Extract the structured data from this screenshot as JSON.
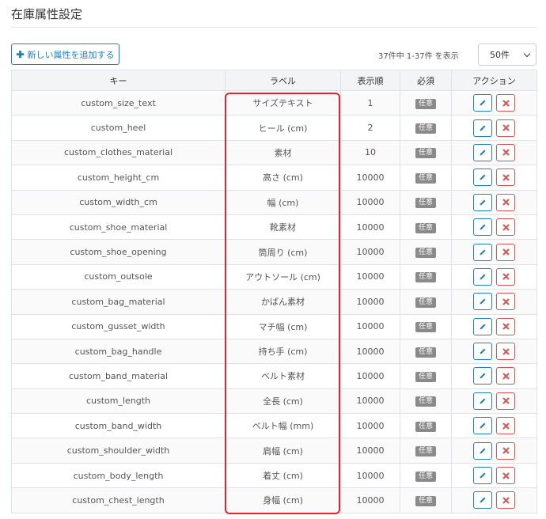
{
  "page": {
    "title": "在庫属性設定"
  },
  "toolbar": {
    "add_label": "新しい属性を追加する",
    "count_text": "37件中 1-37件 を表示",
    "page_size": "50件"
  },
  "table": {
    "headers": {
      "key": "キー",
      "label": "ラベル",
      "order": "表示順",
      "required": "必須",
      "action": "アクション"
    },
    "rows": [
      {
        "key": "custom_size_text",
        "label": "サイズテキスト",
        "order": "1",
        "required": "任意"
      },
      {
        "key": "custom_heel",
        "label": "ヒール (cm)",
        "order": "2",
        "required": "任意"
      },
      {
        "key": "custom_clothes_material",
        "label": "素材",
        "order": "10",
        "required": "任意"
      },
      {
        "key": "custom_height_cm",
        "label": "高さ (cm)",
        "order": "10000",
        "required": "任意"
      },
      {
        "key": "custom_width_cm",
        "label": "幅 (cm)",
        "order": "10000",
        "required": "任意"
      },
      {
        "key": "custom_shoe_material",
        "label": "靴素材",
        "order": "10000",
        "required": "任意"
      },
      {
        "key": "custom_shoe_opening",
        "label": "筒周り (cm)",
        "order": "10000",
        "required": "任意"
      },
      {
        "key": "custom_outsole",
        "label": "アウトソール (cm)",
        "order": "10000",
        "required": "任意"
      },
      {
        "key": "custom_bag_material",
        "label": "かばん素材",
        "order": "10000",
        "required": "任意"
      },
      {
        "key": "custom_gusset_width",
        "label": "マチ幅 (cm)",
        "order": "10000",
        "required": "任意"
      },
      {
        "key": "custom_bag_handle",
        "label": "持ち手 (cm)",
        "order": "10000",
        "required": "任意"
      },
      {
        "key": "custom_band_material",
        "label": "ベルト素材",
        "order": "10000",
        "required": "任意"
      },
      {
        "key": "custom_length",
        "label": "全長 (cm)",
        "order": "10000",
        "required": "任意"
      },
      {
        "key": "custom_band_width",
        "label": "ベルト幅 (mm)",
        "order": "10000",
        "required": "任意"
      },
      {
        "key": "custom_shoulder_width",
        "label": "肩幅 (cm)",
        "order": "10000",
        "required": "任意"
      },
      {
        "key": "custom_body_length",
        "label": "着丈 (cm)",
        "order": "10000",
        "required": "任意"
      },
      {
        "key": "custom_chest_length",
        "label": "身幅 (cm)",
        "order": "10000",
        "required": "任意"
      }
    ]
  },
  "icons": {
    "add": "plus-icon",
    "edit": "pencil-icon",
    "delete": "x-icon",
    "select": "chevron-down-icon"
  },
  "colors": {
    "primary": "#1d80c6",
    "danger": "#d9534f",
    "badge": "#8a8a8a",
    "highlight": "#e8232d"
  }
}
